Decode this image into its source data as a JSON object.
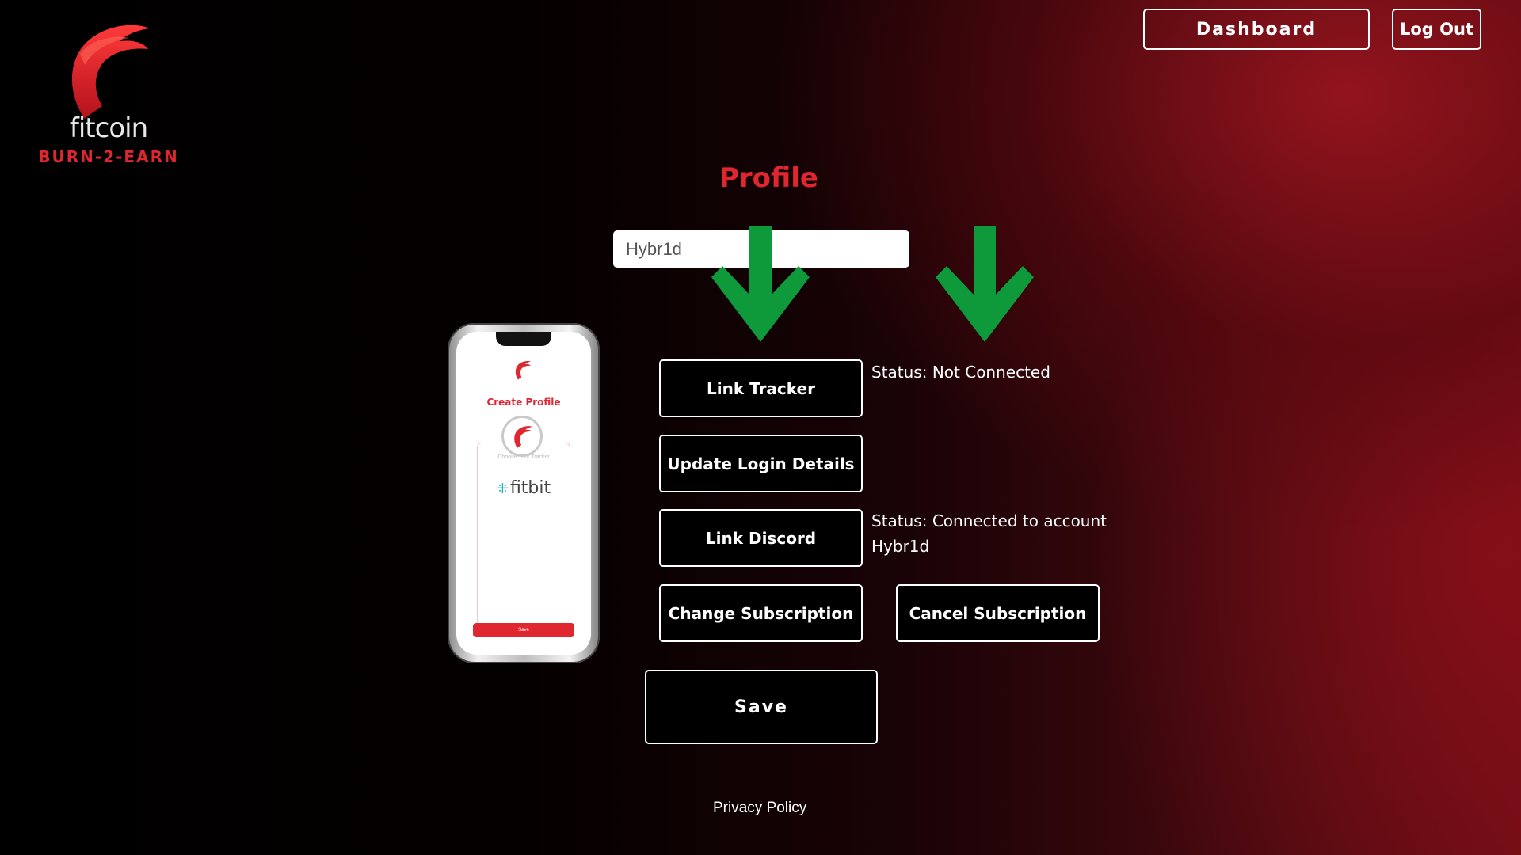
{
  "brand": {
    "name": "fitcoin",
    "tagline": "BURN-2-EARN",
    "accent_color": "#e0262f"
  },
  "nav": {
    "dashboard_label": "Dashboard",
    "logout_label": "Log Out"
  },
  "profile": {
    "title": "Profile",
    "username_value": "Hybr1d"
  },
  "annotations": {
    "arrow_color": "#0e9a3a",
    "icon": "down-arrow-icon"
  },
  "phone_preview": {
    "heading": "Create Profile",
    "card_hint": "Choose Your Tracker",
    "tracker_brand": "fitbit",
    "save_label": "Save"
  },
  "actions": {
    "link_tracker": "Link Tracker",
    "update_login": "Update Login Details",
    "link_discord": "Link Discord",
    "change_subscription": "Change Subscription",
    "cancel_subscription": "Cancel Subscription",
    "save": "Save"
  },
  "status": {
    "tracker": "Status: Not Connected",
    "discord_line1": "Status: Connected to account",
    "discord_line2": "Hybr1d"
  },
  "footer": {
    "privacy_label": "Privacy Policy"
  }
}
